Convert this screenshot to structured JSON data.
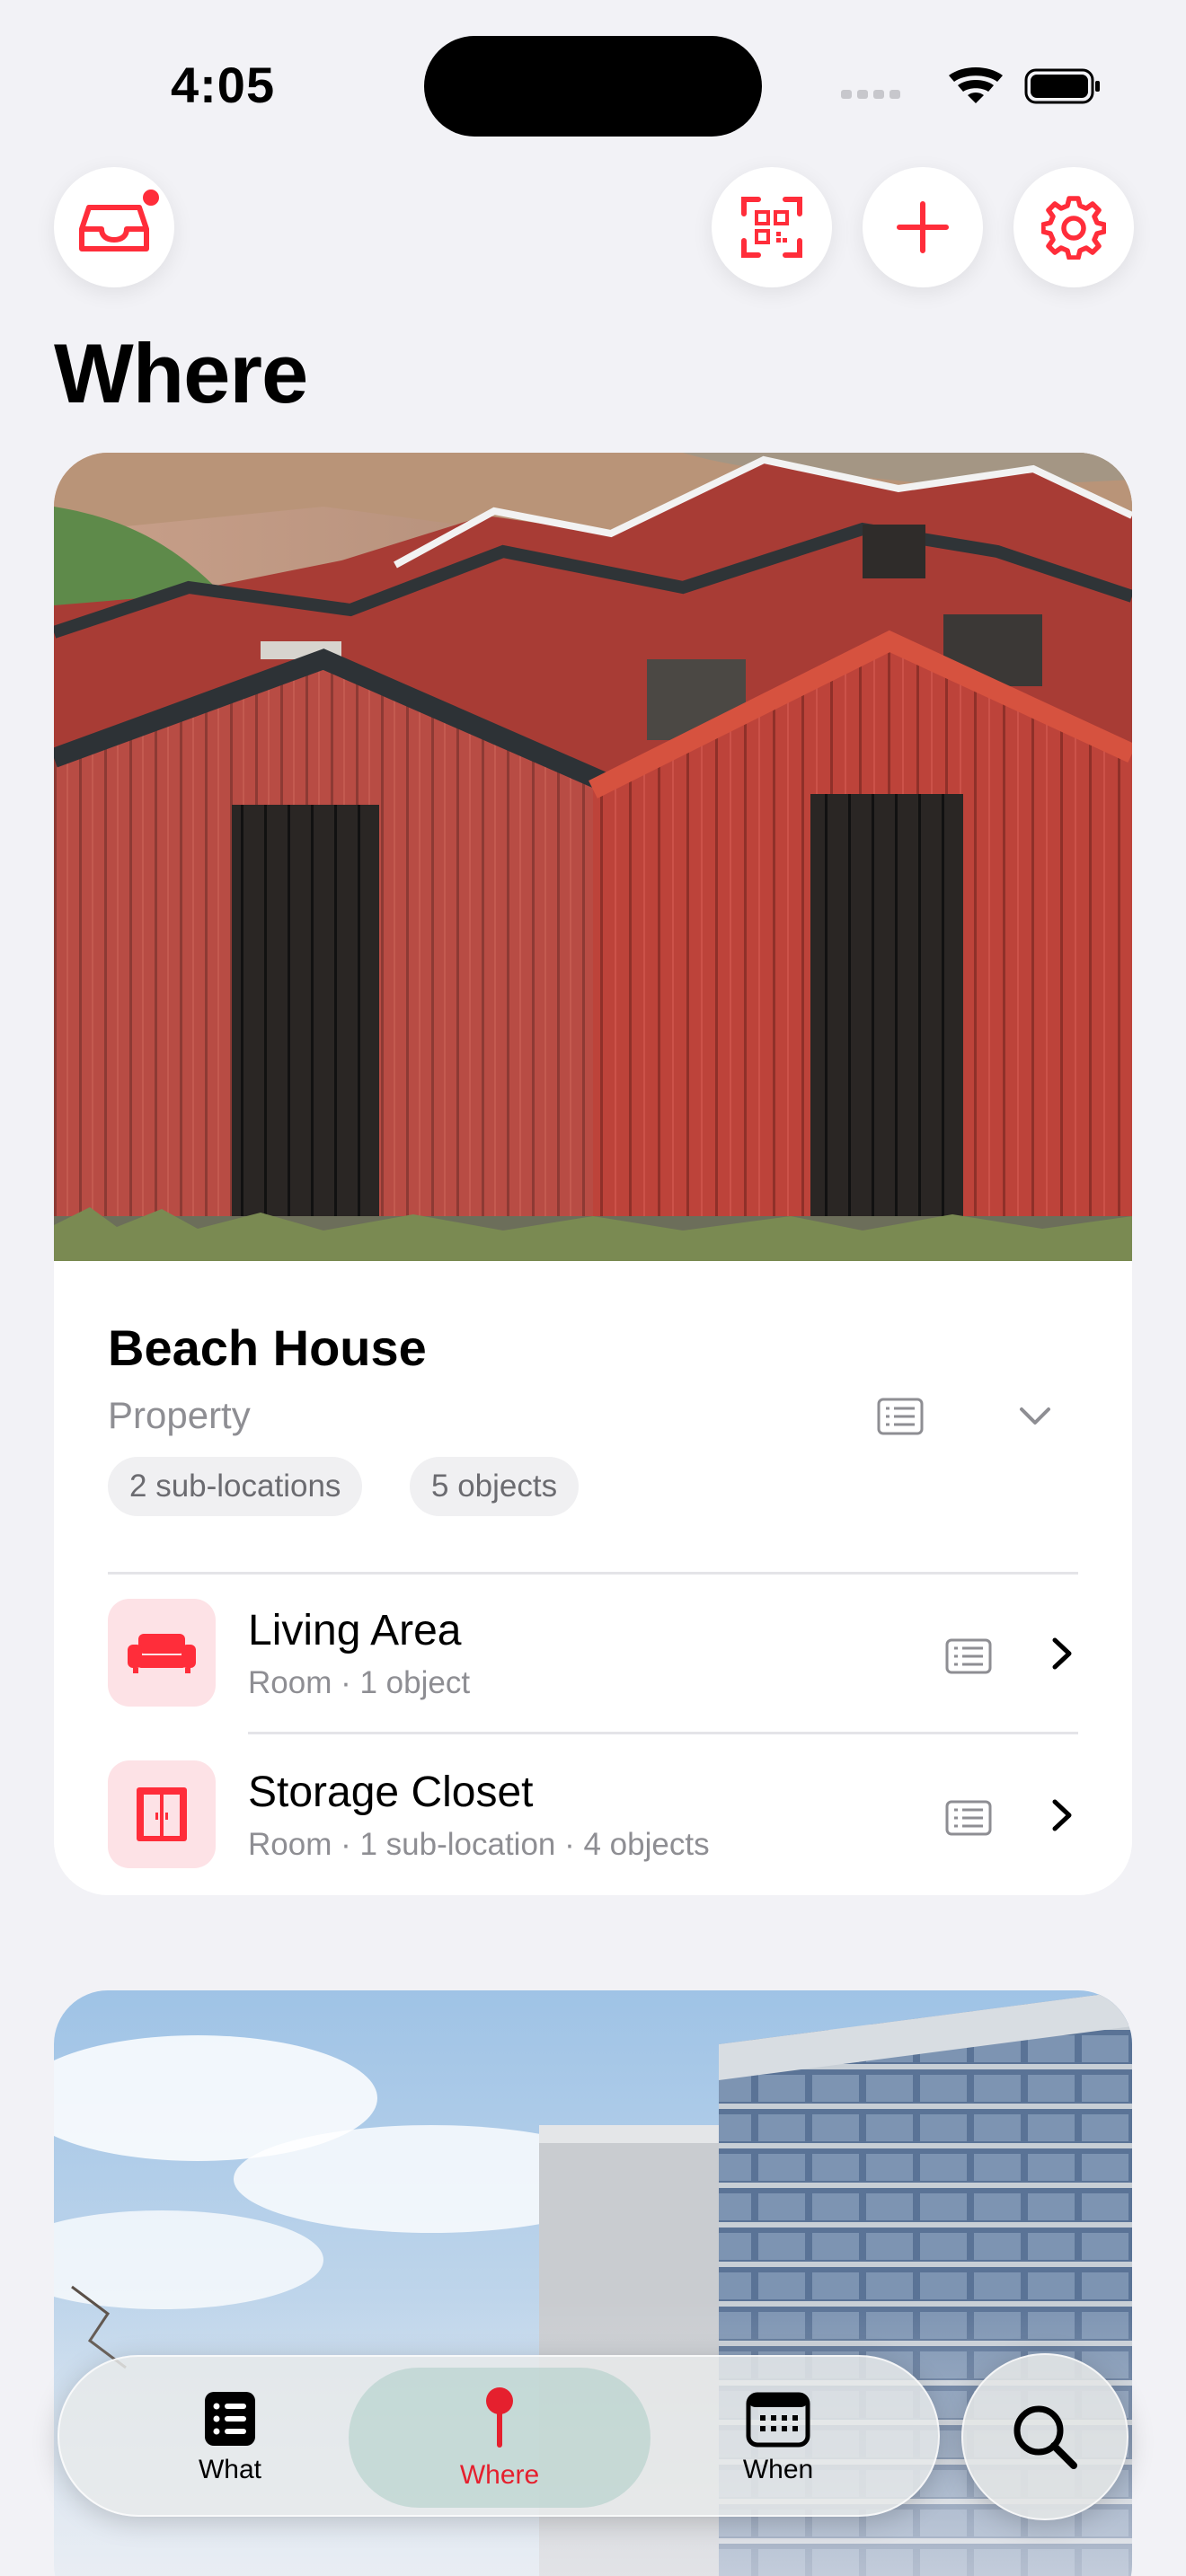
{
  "status": {
    "time": "4:05"
  },
  "header": {
    "title": "Where",
    "inbox_icon": "inbox-tray-icon",
    "scan_icon": "qr-scan-icon",
    "add_icon": "plus-icon",
    "settings_icon": "gear-icon"
  },
  "accent_color": "#ff2d3a",
  "cards": [
    {
      "title": "Beach House",
      "type": "Property",
      "pills": [
        "2 sub-locations",
        "5 objects"
      ],
      "rows": [
        {
          "icon": "sofa-icon",
          "name": "Living Area",
          "meta": "Room · 1 object"
        },
        {
          "icon": "closet-door-icon",
          "name": "Storage Closet",
          "meta": "Room · 1 sub-location · 4 objects"
        }
      ]
    }
  ],
  "tabs": [
    {
      "label": "What",
      "icon": "list-icon",
      "active": false
    },
    {
      "label": "Where",
      "icon": "map-pin-icon",
      "active": true
    },
    {
      "label": "When",
      "icon": "calendar-icon",
      "active": false
    }
  ],
  "search_icon": "magnifier-icon"
}
